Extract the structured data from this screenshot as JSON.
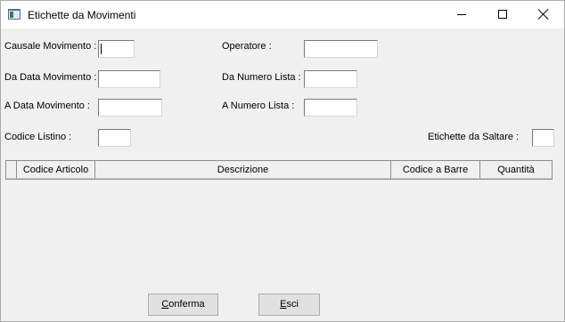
{
  "window": {
    "title": "Etichette da Movimenti"
  },
  "form": {
    "causale_movimento": {
      "label": "Causale Movimento :",
      "value": ""
    },
    "operatore": {
      "label": "Operatore :",
      "value": ""
    },
    "da_data_movimento": {
      "label": "Da Data Movimento  :",
      "value": ""
    },
    "da_numero_lista": {
      "label": "Da Numero Lista :",
      "value": ""
    },
    "a_data_movimento": {
      "label": "A   Data Movimento :",
      "value": ""
    },
    "a_numero_lista": {
      "label": "A  Numero Lista :",
      "value": ""
    },
    "codice_listino": {
      "label": "Codice Listino :",
      "value": ""
    },
    "etichette_da_saltare": {
      "label": "Etichette da Saltare :",
      "value": ""
    }
  },
  "grid": {
    "columns": [
      "Codice Articolo",
      "Descrizione",
      "Codice a Barre",
      "Quantità"
    ],
    "rows": []
  },
  "buttons": {
    "conferma_first": "C",
    "conferma_rest": "onferma",
    "esci_first": "E",
    "esci_rest": "sci"
  },
  "icons": {
    "app": "app-form-icon",
    "minimize": "minimize-icon",
    "maximize": "maximize-icon",
    "close": "close-icon"
  }
}
